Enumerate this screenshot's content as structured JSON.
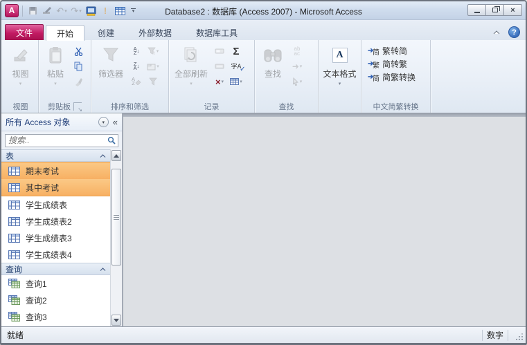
{
  "window": {
    "title": "Database2 : 数据库 (Access 2007) - Microsoft Access"
  },
  "tabs": {
    "file": "文件",
    "items": [
      "开始",
      "创建",
      "外部数据",
      "数据库工具"
    ],
    "active": "开始"
  },
  "icons": {
    "exclamation": "!",
    "undo": "↶",
    "redo": "↷",
    "dropdown": "▾",
    "sum": "Σ",
    "delete": "×",
    "spell": "字A",
    "spell_check": "✓",
    "replace_top": "ab",
    "replace_bottom": "ac",
    "goto_arrow": "➜",
    "select_pointer": "⇖",
    "sort_a": "A",
    "sort_z": "Z",
    "sort_down": "↓",
    "help": "?",
    "pane_collapse": "«",
    "circle_dd": "▾",
    "text_format_A": "A",
    "cn1_char": "简",
    "cn2_char": "繁",
    "cn3_char": "简",
    "cn_arrow": "➔"
  },
  "ribbon": {
    "views": {
      "group_label": "视图",
      "button_label": "视图"
    },
    "clipboard": {
      "group_label": "剪贴板",
      "paste_label": "粘贴"
    },
    "sort": {
      "group_label": "排序和筛选",
      "filter_label": "筛选器"
    },
    "records": {
      "group_label": "记录",
      "refresh_label": "全部刷新"
    },
    "find": {
      "group_label": "查找",
      "find_label": "查找"
    },
    "text_format": {
      "button_label": "文本格式"
    },
    "chinese": {
      "group_label": "中文简繁转换",
      "items": [
        "繁转简",
        "简转繁",
        "简繁转换"
      ]
    }
  },
  "nav": {
    "title": "所有 Access 对象",
    "search_placeholder": "搜索..",
    "sections": [
      {
        "label": "表",
        "items": [
          "期末考试",
          "其中考试",
          "学生成绩表",
          "学生成绩表2",
          "学生成绩表3",
          "学生成绩表4"
        ]
      },
      {
        "label": "查询",
        "items": [
          "查询1",
          "查询2",
          "查询3"
        ]
      }
    ]
  },
  "status": {
    "left": "就绪",
    "right": "数字"
  }
}
